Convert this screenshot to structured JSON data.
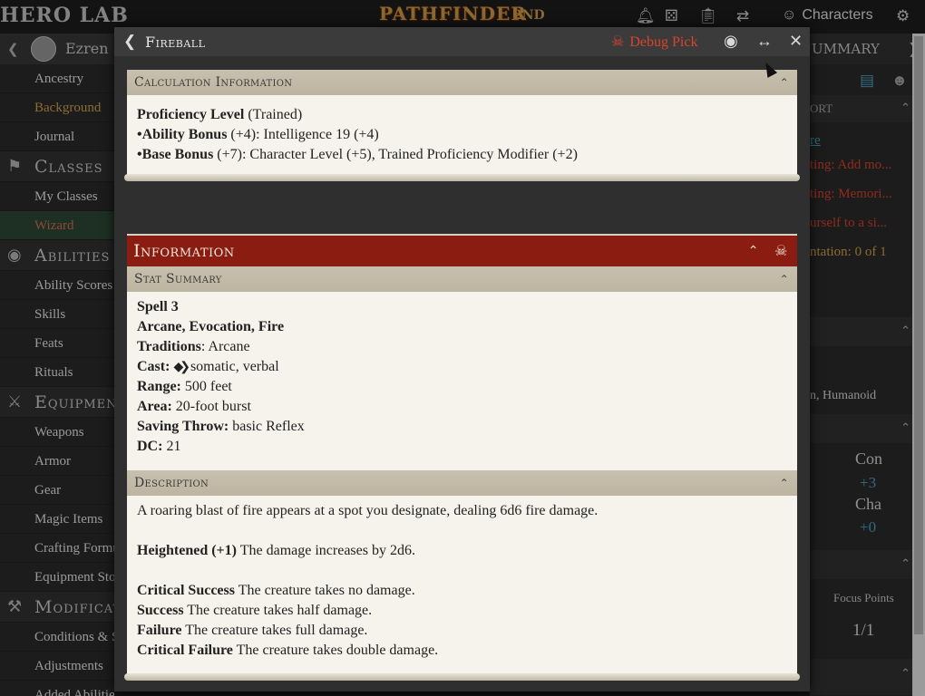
{
  "app": {
    "logo_herolab": "HERO LAB",
    "logo_pathfinder": "PATHFINDER",
    "logo_2nd": "2ND",
    "characters_label": "Characters"
  },
  "sidebar": {
    "character_name": "Ezren",
    "rows": [
      {
        "label": "Ancestry",
        "style": "normal"
      },
      {
        "label": "Background",
        "style": "gold"
      },
      {
        "label": "Journal",
        "style": "normal"
      },
      {
        "label": "Classes",
        "style": "head",
        "icon": "flag-icon"
      },
      {
        "label": "My Classes",
        "style": "normal"
      },
      {
        "label": "Wizard",
        "style": "red"
      },
      {
        "label": "Abilities",
        "style": "head",
        "icon": "eye-icon"
      },
      {
        "label": "Ability Scores",
        "style": "normal"
      },
      {
        "label": "Skills",
        "style": "normal"
      },
      {
        "label": "Feats",
        "style": "normal"
      },
      {
        "label": "Rituals",
        "style": "normal"
      },
      {
        "label": "Equipment",
        "style": "head",
        "icon": "crossed-swords-icon"
      },
      {
        "label": "Weapons",
        "style": "normal"
      },
      {
        "label": "Armor",
        "style": "normal"
      },
      {
        "label": "Gear",
        "style": "normal"
      },
      {
        "label": "Magic Items",
        "style": "normal"
      },
      {
        "label": "Crafting Formulas",
        "style": "normal"
      },
      {
        "label": "Equipment Store",
        "style": "normal"
      },
      {
        "label": "Modifications",
        "style": "head",
        "icon": "wrench-icon"
      },
      {
        "label": "Conditions & Status",
        "style": "normal"
      },
      {
        "label": "Adjustments",
        "style": "normal"
      },
      {
        "label": "Added Abilities",
        "style": "normal"
      }
    ]
  },
  "right_panel": {
    "tab_label": "UMMARY",
    "section_label": "ORT",
    "link_text": "re",
    "warning1": "ting: Add mo...",
    "warning2": "ting: Memori...",
    "warning3": "urself to a si...",
    "implementation": "ntation: 0 of 1",
    "traits": "n, Humanoid",
    "con_label": "Con",
    "con_value": "+3",
    "cha_label": "Cha",
    "cha_value": "+0",
    "focus_label": "Focus Points",
    "focus_value": "1/1"
  },
  "modal": {
    "title": "Fireball",
    "debug_label": "Debug Pick",
    "calc": {
      "header": "Calculation Information",
      "proficiency_label": "Proficiency Level",
      "proficiency_value": " (Trained)",
      "ability_label": "•Ability Bonus",
      "ability_value": " (+4): Intelligence 19 (+4)",
      "base_label": "•Base Bonus",
      "base_value": " (+7): Character Level (+5), Trained Proficiency Modifier (+2)"
    },
    "info": {
      "header": "Information",
      "stat_header": "Stat Summary",
      "spell_level": "Spell 3",
      "traits": "Arcane, Evocation, Fire",
      "traditions_label": "Traditions",
      "traditions_value": ": Arcane",
      "cast_label": "Cast:",
      "cast_value": " somatic, verbal",
      "range_label": "Range:",
      "range_value": " 500 feet",
      "area_label": "Area:",
      "area_value": " 20-foot burst",
      "save_label": "Saving Throw:",
      "save_value": " basic Reflex",
      "dc_label": "DC:",
      "dc_value": " 21",
      "desc_header": "Description",
      "desc_text": "A roaring blast of fire appears at a spot you designate, dealing 6d6 fire damage.",
      "heightened_label": "Heightened (+1)",
      "heightened_value": " The damage increases by 2d6.",
      "crit_success_label": "Critical Success",
      "crit_success_value": " The creature takes no damage.",
      "success_label": "Success",
      "success_value": " The creature takes half damage.",
      "failure_label": "Failure",
      "failure_value": " The creature takes full damage.",
      "crit_failure_label": "Critical Failure",
      "crit_failure_value": " The creature takes double damage."
    }
  }
}
